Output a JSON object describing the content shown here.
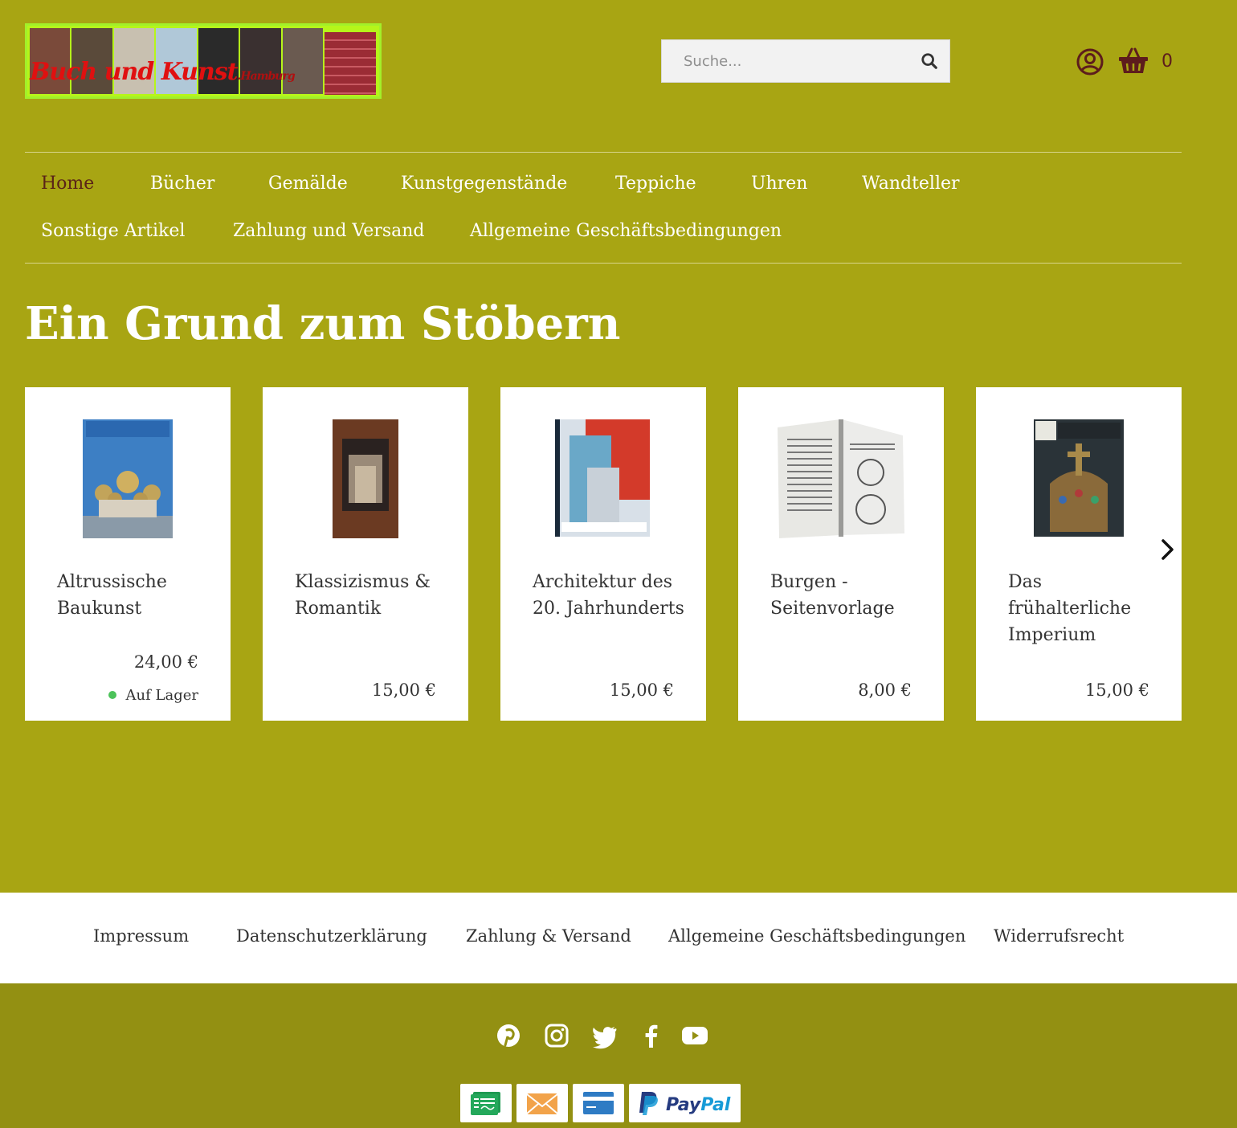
{
  "logo": {
    "alt": "Buch und Kunst Hamburg",
    "text": "Buch und Kunst",
    "subtext": ".Hamburg"
  },
  "search": {
    "placeholder": "Suche..."
  },
  "cart": {
    "count": "0"
  },
  "nav": {
    "items": [
      {
        "label": "Home",
        "active": true
      },
      {
        "label": "Bücher"
      },
      {
        "label": "Gemälde"
      },
      {
        "label": "Kunstgegenstände"
      },
      {
        "label": "Teppiche"
      },
      {
        "label": "Uhren"
      },
      {
        "label": "Wandteller"
      },
      {
        "label": "Sonstige Artikel"
      },
      {
        "label": "Zahlung und Versand"
      },
      {
        "label": "Allgemeine Geschäftsbedingungen"
      }
    ]
  },
  "main": {
    "heading": "Ein Grund zum Stöbern",
    "products": [
      {
        "title": "Altrussische Baukunst",
        "price": "24,00 €",
        "stock": "Auf Lager"
      },
      {
        "title": "Klassizismus & Romantik",
        "price": "15,00 €"
      },
      {
        "title": "Architektur des 20. Jahrhunderts",
        "price": "15,00 €"
      },
      {
        "title": "Burgen - Seitenvorlage",
        "price": "8,00 €"
      },
      {
        "title": "Das frühalterliche Imperium",
        "price": "15,00 €"
      }
    ]
  },
  "footer": {
    "links": [
      "Impressum",
      "Datenschutzerklärung",
      "Zahlung & Versand",
      "Allgemeine Geschäftsbedingungen",
      "Widerrufsrecht"
    ],
    "social_icons": [
      "pinterest-icon",
      "instagram-icon",
      "twitter-icon",
      "facebook-icon",
      "youtube-icon"
    ],
    "payment_icons": [
      "invoice-icon",
      "prepayment-icon",
      "credit-card-icon",
      "paypal-logo"
    ],
    "paypal_label": "PayPal"
  },
  "colors": {
    "background": "#a8a513",
    "footer_dark": "#939012",
    "nav_active": "#5a2317",
    "icon": "#5d1c1c",
    "stock_dot": "#4cc35a"
  }
}
